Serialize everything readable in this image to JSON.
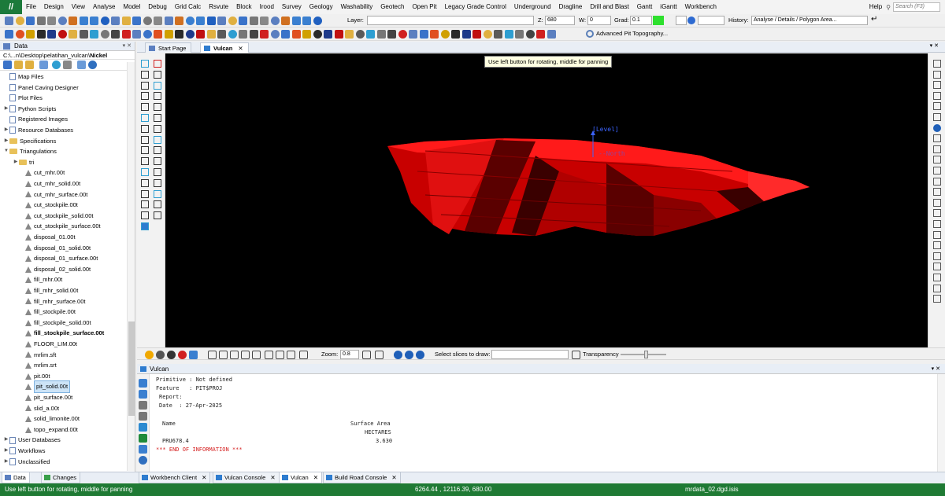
{
  "menubar": {
    "logo": "//",
    "items": [
      "File",
      "Design",
      "View",
      "Analyse",
      "Model",
      "Debug",
      "Grid Calc",
      "Rsvute",
      "Block",
      "Irood",
      "Survey",
      "Geology",
      "Washability",
      "Geotech",
      "Open Pit",
      "Legacy Grade Control",
      "Underground",
      "Dragline",
      "Drill and Blast",
      "Gantt",
      "iGantt",
      "Workbench"
    ],
    "help": "Help",
    "search_placeholder": "Search (F3)"
  },
  "toolbar2": {
    "layer_label": "Layer:",
    "z_label": "Z:",
    "z_value": "680",
    "w_label": "W:",
    "w_value": "0",
    "grad_label": "Grad:",
    "grad_value": "0.1",
    "history_label": "History:",
    "history_value": "Analyse / Details / Polygon Area..."
  },
  "toolbar3": {
    "advanced_pit": "Advanced Pit Topography..."
  },
  "left_panel": {
    "title": "Data",
    "path_prefix": "C:\\...n\\Desktop\\pelatihan_vulcan\\",
    "path_bold": "Nickel",
    "tree": [
      {
        "label": "Map Files",
        "indent": 1,
        "icon": "page",
        "arrow": ""
      },
      {
        "label": "Panel Caving Designer",
        "indent": 1,
        "icon": "page",
        "arrow": ""
      },
      {
        "label": "Plot Files",
        "indent": 1,
        "icon": "page",
        "arrow": ""
      },
      {
        "label": "Python Scripts",
        "indent": 1,
        "icon": "page",
        "arrow": "▶"
      },
      {
        "label": "Registered Images",
        "indent": 1,
        "icon": "page",
        "arrow": ""
      },
      {
        "label": "Resource Databases",
        "indent": 1,
        "icon": "page",
        "arrow": "▶"
      },
      {
        "label": "Specifications",
        "indent": 1,
        "icon": "folder",
        "arrow": "▶"
      },
      {
        "label": "Triangulations",
        "indent": 1,
        "icon": "folder",
        "arrow": "▼"
      },
      {
        "label": "tri",
        "indent": 2,
        "icon": "folder",
        "arrow": "▶"
      },
      {
        "label": "cut_mhr.00t",
        "indent": 3,
        "icon": "tri",
        "arrow": ""
      },
      {
        "label": "cut_mhr_solid.00t",
        "indent": 3,
        "icon": "tri",
        "arrow": ""
      },
      {
        "label": "cut_mhr_surface.00t",
        "indent": 3,
        "icon": "tri",
        "arrow": ""
      },
      {
        "label": "cut_stockpile.00t",
        "indent": 3,
        "icon": "tri",
        "arrow": ""
      },
      {
        "label": "cut_stockpile_solid.00t",
        "indent": 3,
        "icon": "tri",
        "arrow": ""
      },
      {
        "label": "cut_stockpile_surface.00t",
        "indent": 3,
        "icon": "tri",
        "arrow": ""
      },
      {
        "label": "disposal_01.00t",
        "indent": 3,
        "icon": "tri",
        "arrow": ""
      },
      {
        "label": "disposal_01_solid.00t",
        "indent": 3,
        "icon": "tri",
        "arrow": ""
      },
      {
        "label": "disposal_01_surface.00t",
        "indent": 3,
        "icon": "tri",
        "arrow": ""
      },
      {
        "label": "disposal_02_solid.00t",
        "indent": 3,
        "icon": "tri",
        "arrow": ""
      },
      {
        "label": "fill_mhr.00t",
        "indent": 3,
        "icon": "tri",
        "arrow": ""
      },
      {
        "label": "fill_mhr_solid.00t",
        "indent": 3,
        "icon": "tri",
        "arrow": ""
      },
      {
        "label": "fill_mhr_surface.00t",
        "indent": 3,
        "icon": "tri",
        "arrow": ""
      },
      {
        "label": "fill_stockpile.00t",
        "indent": 3,
        "icon": "tri",
        "arrow": ""
      },
      {
        "label": "fill_stockpile_solid.00t",
        "indent": 3,
        "icon": "tri",
        "arrow": ""
      },
      {
        "label": "fill_stockpile_surface.00t",
        "indent": 3,
        "icon": "tri",
        "arrow": "",
        "bold": true
      },
      {
        "label": "FLOOR_LIM.00t",
        "indent": 3,
        "icon": "tri",
        "arrow": ""
      },
      {
        "label": "mrlim.sft",
        "indent": 3,
        "icon": "tri",
        "arrow": ""
      },
      {
        "label": "mrlim.srt",
        "indent": 3,
        "icon": "tri",
        "arrow": ""
      },
      {
        "label": "pit.00t",
        "indent": 3,
        "icon": "tri",
        "arrow": ""
      },
      {
        "label": "pit_solid.00t",
        "indent": 3,
        "icon": "tri",
        "arrow": "",
        "selected": true
      },
      {
        "label": "pit_surface.00t",
        "indent": 3,
        "icon": "tri",
        "arrow": ""
      },
      {
        "label": "slid_a.00t",
        "indent": 3,
        "icon": "tri",
        "arrow": ""
      },
      {
        "label": "solid_limonite.00t",
        "indent": 3,
        "icon": "tri",
        "arrow": ""
      },
      {
        "label": "topo_expand.00t",
        "indent": 3,
        "icon": "tri",
        "arrow": ""
      },
      {
        "label": "User Databases",
        "indent": 1,
        "icon": "page",
        "arrow": "▶"
      },
      {
        "label": "Workflows",
        "indent": 1,
        "icon": "page",
        "arrow": "▶"
      },
      {
        "label": "Unclassified",
        "indent": 1,
        "icon": "page",
        "arrow": "▶"
      }
    ]
  },
  "doc_tabs": {
    "start": "Start Page",
    "vulcan": "Vulcan"
  },
  "viewport": {
    "tooltip": "Use left button for rotating, middle for panning",
    "level_label": "[Level]",
    "north_label": "--North"
  },
  "viewbar": {
    "zoom_label": "Zoom:",
    "zoom_value": "0.8",
    "slices_label": "Select slices to draw:",
    "transparency_label": "Transparency"
  },
  "output_panel": {
    "title": "Vulcan",
    "lines": {
      "primitive": "Primitive : Not defined",
      "feature": "Feature   : PIT$PROJ",
      "report": "Report:",
      "date": "Date  : 27-Apr-2025",
      "name_hdr": "Name",
      "area_hdr": "Surface Area",
      "unit_hdr": "HECTARES",
      "name_val": "PRU678.4",
      "area_val": "3.630",
      "end": "*** END OF INFORMATION ***"
    }
  },
  "bottom_tabs": {
    "data": "Data",
    "changes": "Changes",
    "workbench": "Workbench Client",
    "console": "Vulcan Console",
    "vulcan": "Vulcan",
    "build_road": "Build Road Console"
  },
  "status": {
    "hint": "Use left button for rotating, middle for panning",
    "coords": "6264.44 , 12116.39, 680.00",
    "file": "mrdata_02.dgd.isis"
  },
  "colors": {
    "status_bar": "#1f7a34",
    "pit_red": "#e01010",
    "viewport_bg": "#000000"
  }
}
